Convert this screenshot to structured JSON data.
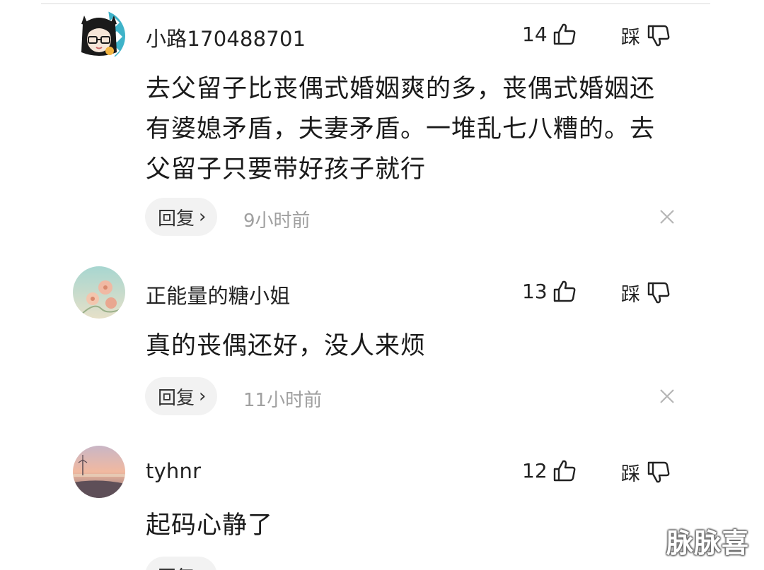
{
  "comments": [
    {
      "username": "小路170488701",
      "like_count": "14",
      "dislike_label": "踩",
      "content_lines": [
        "去父留子比丧偶式婚姻爽的多，丧偶式婚姻还",
        "有婆媳矛盾，夫妻矛盾。一堆乱七八糟的。去",
        "父留子只要带好孩子就行"
      ],
      "reply_label": "回复",
      "time": "9小时前"
    },
    {
      "username": "正能量的糖小姐",
      "like_count": "13",
      "dislike_label": "踩",
      "content_lines": [
        "真的丧偶还好，没人来烦"
      ],
      "reply_label": "回复",
      "time": "11小时前"
    },
    {
      "username": "tyhnr",
      "like_count": "12",
      "dislike_label": "踩",
      "content_lines": [
        "起码心静了"
      ],
      "reply_label": "回复",
      "time": ""
    }
  ],
  "watermark": "脉脉喜",
  "icons": {
    "like": "thumbs-up-icon",
    "dislike": "thumbs-down-icon",
    "reply_chevron": "chevron-right-icon",
    "close": "close-icon"
  },
  "colors": {
    "text": "#1a1a1a",
    "muted": "#a0a0a0",
    "reply_bg": "#f2f2f2"
  }
}
